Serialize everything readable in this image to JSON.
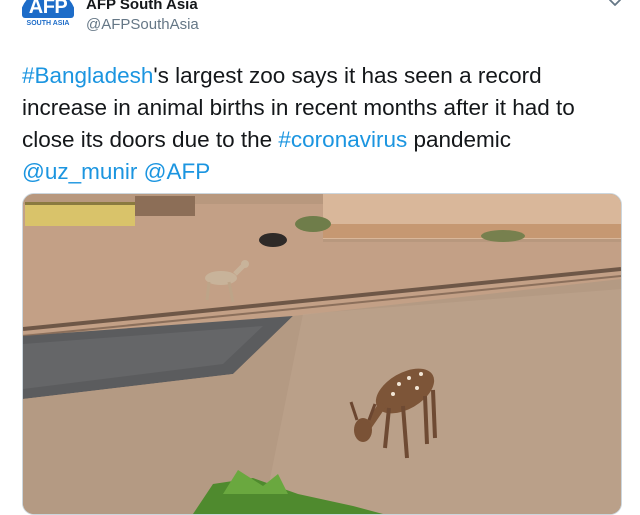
{
  "account": {
    "logo_text": "AFP",
    "logo_subtext": "SOUTH ASIA",
    "display_name": "AFP South Asia",
    "handle": "@AFPSouthAsia"
  },
  "tweet": {
    "hashtag_1": "#Bangladesh",
    "text_1": "'s largest zoo says it has seen a record increase in animal births in recent months after it had to close its doors due to the ",
    "hashtag_2": "#coronavirus",
    "text_2": " pandemic",
    "mention_1": "@uz_munir",
    "mention_2": "@AFP"
  },
  "icons": {
    "caret": "chevron-down-icon"
  },
  "colors": {
    "link": "#1b95e0",
    "brand": "#1d6cc8",
    "text": "#14171a",
    "secondary": "#657786"
  }
}
